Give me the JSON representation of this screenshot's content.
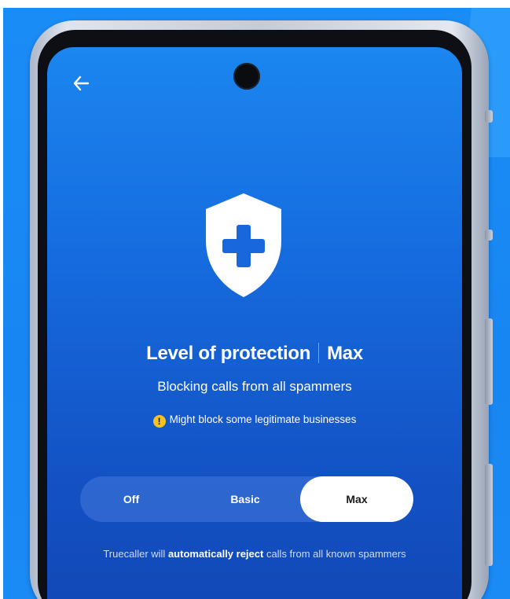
{
  "screen": {
    "back_icon": "arrow-left-icon",
    "shield_icon": "shield-plus-icon",
    "title": {
      "label": "Level of protection",
      "value": "Max"
    },
    "subtitle": "Blocking calls from all spammers",
    "warning": {
      "icon": "exclamation-circle-icon",
      "text": "Might block some legitimate businesses"
    },
    "segments": {
      "off": "Off",
      "basic": "Basic",
      "max": "Max",
      "selected": "Max"
    },
    "footer": {
      "part1": "Truecaller will ",
      "bold": "automatically reject",
      "part2": " calls from all known spammers"
    }
  },
  "colors": {
    "background": "#1a8cf6",
    "screen_top": "#1b86f0",
    "screen_bottom": "#1247b6",
    "warning": "#f6c21c",
    "selected_segment": "#ffffff"
  }
}
